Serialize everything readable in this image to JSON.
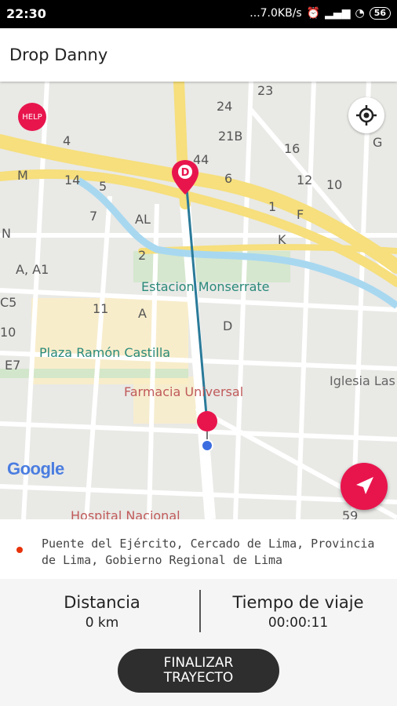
{
  "status_bar": {
    "time": "22:30",
    "network": "...7.0KB/s",
    "battery": "56"
  },
  "app_bar": {
    "title": "Drop Danny"
  },
  "map": {
    "help_label": "HELP",
    "google_logo": "Google",
    "origin_marker_letter": "D",
    "labels": [
      "23",
      "24",
      "21B",
      "16",
      "G",
      "4",
      "44",
      "6",
      "12",
      "10",
      "M",
      "14",
      "5",
      "1",
      "F",
      "7",
      "AL",
      "N",
      "K",
      "2",
      "A, A1",
      "C5",
      "11",
      "A",
      "D",
      "10",
      "E7",
      "59"
    ],
    "places": [
      "Estacion Monserrate",
      "Plaza Ramón Castilla",
      "Farmacia Universal",
      "Iglesia Las",
      "Hospital Nacional"
    ],
    "icons": [
      "help-icon",
      "locate-icon",
      "navigation-arrow-icon"
    ]
  },
  "address": {
    "text": "Puente del Ejército, Cercado de Lima, Provincia de Lima, Gobierno Regional de Lima"
  },
  "stats": {
    "distance_label": "Distancia",
    "distance_value": "0 km",
    "time_label": "Tiempo de viaje",
    "time_value": "00:00:11"
  },
  "finish_button": {
    "label_line1": "FINALIZAR",
    "label_line2": "TRAYECTO"
  },
  "colors": {
    "accent": "#e8154d",
    "route": "#2a7a99",
    "road_yellow": "#f6df7c",
    "water": "#a8d8f0"
  }
}
